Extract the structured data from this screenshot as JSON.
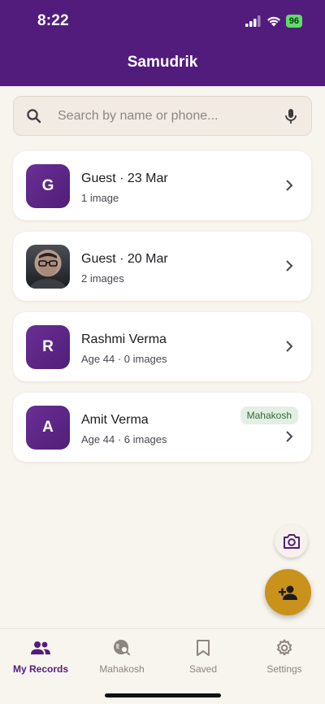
{
  "status_bar": {
    "time": "8:22",
    "battery": "96"
  },
  "header": {
    "title": "Samudrik"
  },
  "search": {
    "placeholder": "Search by name or phone..."
  },
  "records": [
    {
      "initial": "G",
      "name": "Guest · 23 Mar",
      "sub": "1 image"
    },
    {
      "initial": "",
      "name": "Guest · 20 Mar",
      "sub": "2 images",
      "photo": true
    },
    {
      "initial": "R",
      "name": "Rashmi Verma",
      "sub": "Age 44  ·  0 images"
    },
    {
      "initial": "A",
      "name": "Amit Verma",
      "sub": "Age 44  ·  6 images",
      "tag": "Mahakosh"
    }
  ],
  "nav": {
    "items": [
      {
        "label": "My Records",
        "icon": "people-icon",
        "active": true
      },
      {
        "label": "Mahakosh",
        "icon": "globe-search-icon",
        "active": false
      },
      {
        "label": "Saved",
        "icon": "bookmark-icon",
        "active": false
      },
      {
        "label": "Settings",
        "icon": "gear-icon",
        "active": false
      }
    ]
  },
  "colors": {
    "primary": "#521c7d",
    "accent": "#c9921a",
    "background": "#f8f4ee"
  }
}
